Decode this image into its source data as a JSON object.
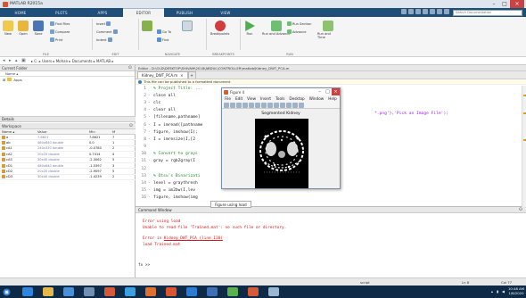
{
  "window": {
    "title": "MATLAB R2015a"
  },
  "ribbon_tabs": [
    "HOME",
    "PLOTS",
    "APPS",
    "EDITOR",
    "PUBLISH",
    "VIEW"
  ],
  "active_tab": "EDITOR",
  "search": {
    "placeholder": "Search Documentation"
  },
  "ribbon": {
    "file": {
      "new": "New",
      "open": "Open",
      "save": "Save",
      "find_files": "Find Files",
      "compare": "Compare",
      "print": "Print"
    },
    "edit": {
      "insert": "Insert",
      "comment": "Comment",
      "indent": "Indent"
    },
    "navigate": {
      "go_to": "Go To",
      "find": "Find"
    },
    "breakpoints": {
      "label": "Breakpoints"
    },
    "run": {
      "run": "Run",
      "run_and_advance": "Run and Advance",
      "run_section": "Run Section",
      "advance": "Advance",
      "run_and_time": "Run and Time"
    }
  },
  "group_labels": {
    "file": "FILE",
    "edit": "EDIT",
    "navigate": "NAVIGATE",
    "breakpoints": "BREAKPOINTS",
    "run": "RUN"
  },
  "address": {
    "path": "▸ C: ▸ Users ▸ Mohan ▸ Documents ▸ MATLAB ▸"
  },
  "current_folder": {
    "header": "Current Folder",
    "col_name": "Name ▴",
    "items": [
      "Apps"
    ]
  },
  "details": {
    "label": "Details"
  },
  "workspace": {
    "header": "Workspace",
    "columns": [
      "Name ▴",
      "Value",
      "Min",
      "M"
    ],
    "rows": [
      {
        "name": "a",
        "value": "7.8621",
        "min": "7.8621",
        "max": "7"
      },
      {
        "name": "ab",
        "value": "480x640 double",
        "min": "0.0",
        "max": "1"
      },
      {
        "name": "cA1",
        "value": "240x320 double",
        "min": "-0.0780",
        "max": "2"
      },
      {
        "name": "cA2",
        "value": "20x20 double",
        "min": "0.7414",
        "max": "4"
      },
      {
        "name": "cA3",
        "value": "30x40 double",
        "min": "-2.3062",
        "max": "5"
      },
      {
        "name": "cD1",
        "value": "480x640 double",
        "min": "-1.5397",
        "max": "3"
      },
      {
        "name": "cD2",
        "value": "20x20 double",
        "min": "-2.9097",
        "max": "5"
      },
      {
        "name": "cD3",
        "value": "30x40 double",
        "min": "-1.4239",
        "max": "2"
      }
    ]
  },
  "editor": {
    "header": "Editor - D:\\OLD\\DESKTOP\\SHIVAM\\2018\\ABDUL\\CONTROLLER\\matlab\\Kidney_DWT_PCA.m",
    "tabs": [
      "Kidney_DWT_PCA.m",
      "+"
    ],
    "notice": "This file can be published to a formatted document",
    "lines": [
      {
        "n": "1",
        "d": "",
        "t": "% Project Title: ...",
        "k": "cmt"
      },
      {
        "n": "2",
        "d": "-",
        "t": "close all",
        "k": ""
      },
      {
        "n": "3",
        "d": "-",
        "t": "clc",
        "k": ""
      },
      {
        "n": "4",
        "d": "-",
        "t": "clear all",
        "k": ""
      },
      {
        "n": "5",
        "d": "-",
        "t": "[filename,pathname]",
        "k": ""
      },
      {
        "n": "6",
        "d": "-",
        "t": "I = imread([pathname",
        "k": ""
      },
      {
        "n": "7",
        "d": "-",
        "t": "figure, imshow(I);",
        "k": ""
      },
      {
        "n": "8",
        "d": "-",
        "t": "I = imresize(I,[2",
        "k": ""
      },
      {
        "n": "9",
        "d": "",
        "t": "",
        "k": ""
      },
      {
        "n": "10",
        "d": "",
        "t": "% Convert to grays",
        "k": "cmt"
      },
      {
        "n": "11",
        "d": "-",
        "t": "gray = rgb2gray(I",
        "k": ""
      },
      {
        "n": "12",
        "d": "",
        "t": "",
        "k": ""
      },
      {
        "n": "13",
        "d": "",
        "t": "% Otsu's Binarizati",
        "k": "cmt"
      },
      {
        "n": "14",
        "d": "-",
        "t": "level = graythresh",
        "k": ""
      },
      {
        "n": "15",
        "d": "-",
        "t": "img = im2bw(I,lev",
        "k": ""
      },
      {
        "n": "16",
        "d": "-",
        "t": "figure, imshow(img",
        "k": ""
      }
    ],
    "right_fragment": "*.png'},'Pick an Image File');"
  },
  "command_window": {
    "header": "Command Window",
    "err1": "Error using load",
    "err2": "Unable to read file 'Trained.mat': no such file or directory.",
    "err3_prefix": "Error in ",
    "err3_link": "Kidney_DWT_PCA (line 130)",
    "err4": "load Trained.mat",
    "prompt": "fx >>"
  },
  "figure": {
    "title": "Figure 4",
    "menu": [
      "File",
      "Edit",
      "View",
      "Insert",
      "Tools",
      "Desktop",
      "Window",
      "Help"
    ],
    "plot_title": "Segmented Kidney"
  },
  "loading": {
    "text": "Figure using load"
  },
  "status": {
    "script": "script",
    "ln": "Ln 8",
    "col": "Col 77"
  },
  "taskbar": {
    "time": "10:48 AM",
    "date": "1/6/2020"
  },
  "colors": {
    "accent": "#1f4e79",
    "error": "#d21a1a",
    "comment": "#228b22",
    "string": "#a020f0"
  }
}
